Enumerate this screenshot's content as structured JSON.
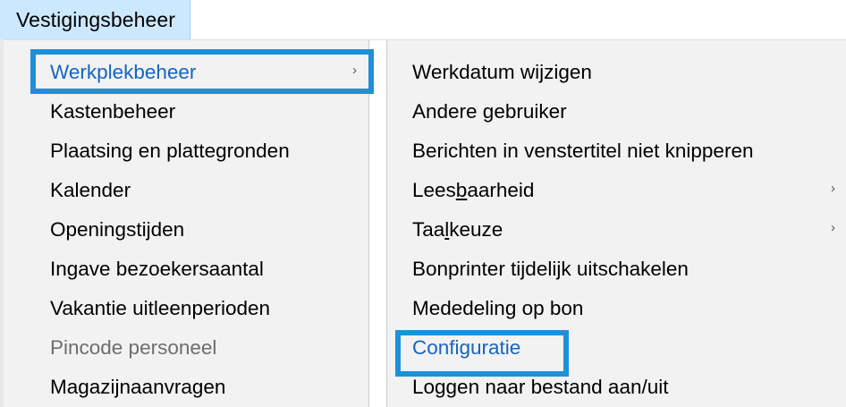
{
  "menubar": {
    "title": "Vestigingsbeheer"
  },
  "main_menu": {
    "items": [
      {
        "label": "Werkplekbeheer",
        "submenu_arrow": "›"
      },
      {
        "label": "Kastenbeheer"
      },
      {
        "label": "Plaatsing en plattegronden"
      },
      {
        "label": "Kalender"
      },
      {
        "label": "Openingstijden"
      },
      {
        "label": "Ingave bezoekersaantal"
      },
      {
        "label": "Vakantie uitleenperioden"
      },
      {
        "label": "Pincode personeel"
      },
      {
        "label": "Magazijnaanvragen"
      }
    ]
  },
  "sub_menu": {
    "items": [
      {
        "label": "Werkdatum wijzigen"
      },
      {
        "label": "Andere gebruiker"
      },
      {
        "label": "Berichten in venstertitel niet knipperen"
      },
      {
        "label_pre": "Lees",
        "label_mnemonic": "b",
        "label_post": "aarheid",
        "submenu_arrow": "›"
      },
      {
        "label_pre": "Taa",
        "label_mnemonic": "l",
        "label_post": "keuze",
        "submenu_arrow": "›"
      },
      {
        "label": "Bonprinter tijdelijk uitschakelen"
      },
      {
        "label": "Mededeling op bon"
      },
      {
        "label": "Configuratie"
      },
      {
        "label": "Loggen naar bestand aan/uit"
      }
    ]
  },
  "colors": {
    "menubar_highlight": "#cce8ff",
    "active_text": "#1565c0",
    "annotation_box": "#1e90d8",
    "disabled_text": "#6d6d6d"
  }
}
